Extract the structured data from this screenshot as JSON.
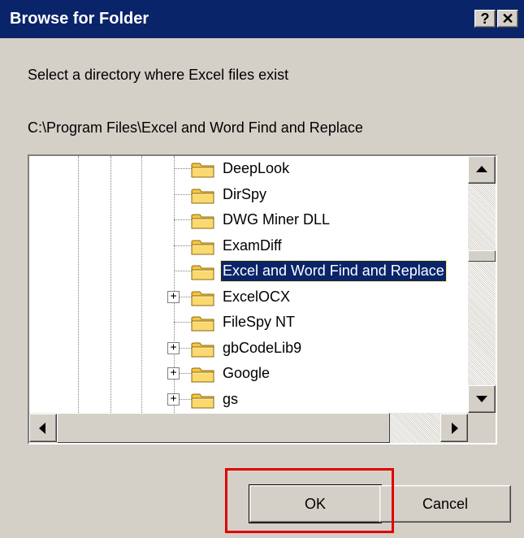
{
  "window": {
    "title": "Browse for Folder",
    "help_glyph": "?",
    "close_glyph": "✕"
  },
  "message": "Select a directory where Excel files exist",
  "current_path": "C:\\Program Files\\Excel and Word Find and Replace",
  "tree": {
    "items": [
      {
        "label": "DeepLook",
        "expandable": false,
        "selected": false
      },
      {
        "label": "DirSpy",
        "expandable": false,
        "selected": false
      },
      {
        "label": "DWG Miner DLL",
        "expandable": false,
        "selected": false
      },
      {
        "label": "ExamDiff",
        "expandable": false,
        "selected": false
      },
      {
        "label": "Excel and Word Find and Replace",
        "expandable": false,
        "selected": true
      },
      {
        "label": "ExcelOCX",
        "expandable": true,
        "selected": false
      },
      {
        "label": "FileSpy NT",
        "expandable": false,
        "selected": false
      },
      {
        "label": "gbCodeLib9",
        "expandable": true,
        "selected": false
      },
      {
        "label": "Google",
        "expandable": true,
        "selected": false
      },
      {
        "label": "gs",
        "expandable": true,
        "selected": false
      }
    ],
    "expander_glyph": "+"
  },
  "buttons": {
    "ok_label": "OK",
    "cancel_label": "Cancel"
  },
  "colors": {
    "titlebar": "#0a246a",
    "selection": "#0a246a",
    "dialog_bg": "#d4d0c8",
    "highlight_box": "#e00000",
    "folder": "#f5c542"
  }
}
